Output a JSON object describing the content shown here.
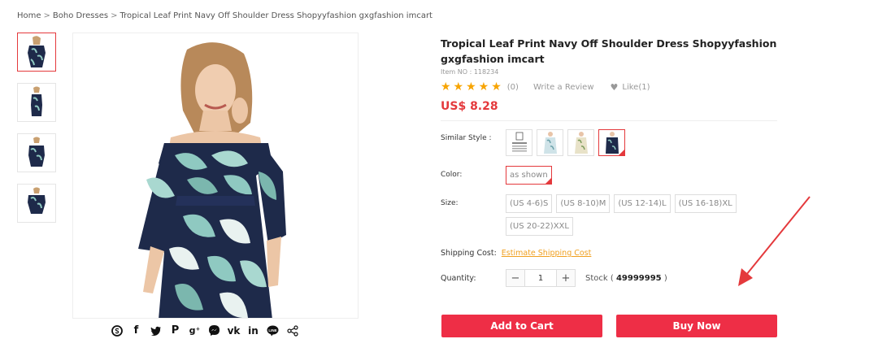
{
  "breadcrumb": {
    "home": "Home",
    "sep": ">",
    "category": "Boho Dresses",
    "current": "Tropical Leaf Print Navy Off Shoulder Dress Shopyyfashion gxgfashion imcart"
  },
  "product": {
    "title": "Tropical Leaf Print Navy Off Shoulder Dress Shopyyfashion gxgfashion imcart",
    "item_no": "Item NO : 118234",
    "stars": "★★★★★",
    "rating_count": "(0)",
    "write_review": "Write a Review",
    "like": "Like(1)",
    "price": "US$ 8.28"
  },
  "options": {
    "similar_label": "Similar Style :",
    "color_label": "Color:",
    "color_value": "as shown",
    "size_label": "Size:",
    "sizes": [
      "(US 4-6)S",
      "(US 8-10)M",
      "(US 12-14)L",
      "(US 16-18)XL",
      "(US 20-22)XXL"
    ],
    "shipping_label": "Shipping Cost:",
    "shipping_link": "Estimate Shipping Cost",
    "quantity_label": "Quantity:",
    "quantity_value": "1",
    "minus": "−",
    "plus": "+",
    "stock_prefix": "Stock (",
    "stock_value": "49999995",
    "stock_suffix": ")"
  },
  "buttons": {
    "add_to_cart": "Add to Cart",
    "buy_now": "Buy Now"
  },
  "share_icons": [
    "skype-icon",
    "facebook-icon",
    "twitter-icon",
    "pinterest-icon",
    "google-plus-icon",
    "messenger-icon",
    "vk-icon",
    "linkedin-icon",
    "line-icon",
    "share-icon"
  ],
  "colors": {
    "accent": "#e4393c",
    "button": "#ee2e46",
    "star": "#f7a400",
    "link": "#f0a020",
    "dress_navy": "#1e2a4a",
    "leaf": "#8fc9c1"
  }
}
